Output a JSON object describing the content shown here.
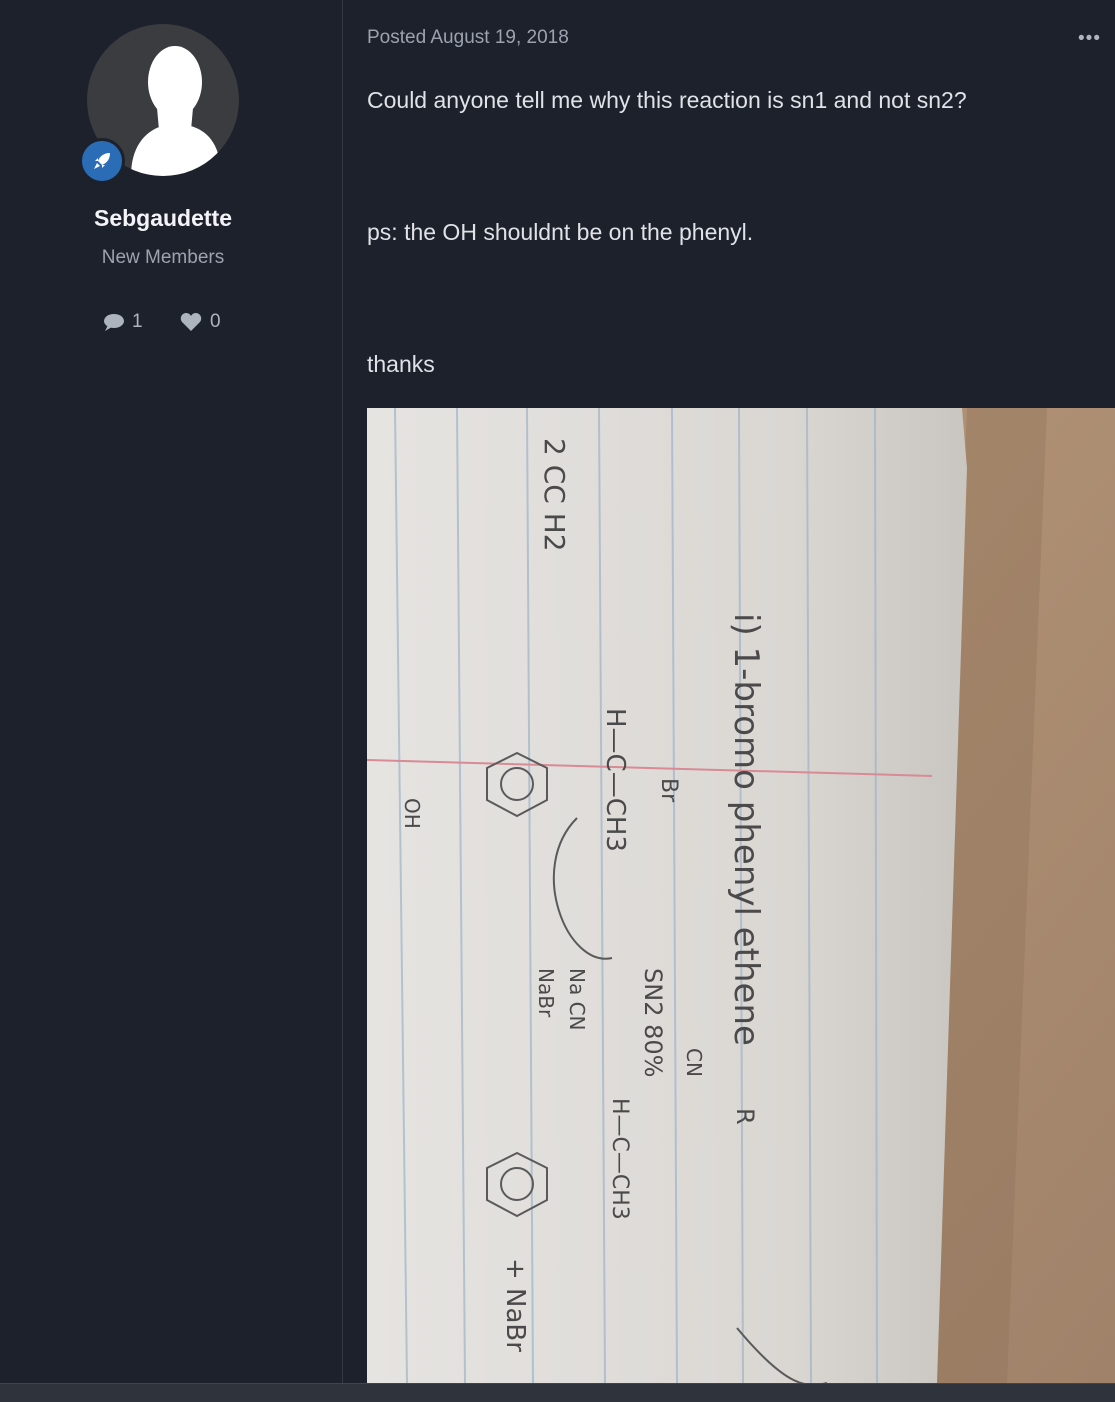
{
  "author": {
    "name": "Sebgaudette",
    "group": "New Members",
    "avatar_icon": "default-user-silhouette-icon",
    "badge_icon": "rocket-icon",
    "badge_color": "#2b6cb7",
    "stats": {
      "posts_icon": "comment-icon",
      "posts": "1",
      "reputation_icon": "heart-icon",
      "reputation": "0"
    }
  },
  "post": {
    "date": "Posted August 19, 2018",
    "menu_icon": "ellipsis-icon",
    "paragraphs": [
      "Could anyone tell me why this reaction is sn1 and not sn2?",
      "ps: the OH shouldnt be on the phenyl.",
      "thanks"
    ]
  },
  "attachment": {
    "type": "photo of handwritten notes",
    "handwriting": [
      "i) 1-bromo phenyl ethene",
      "2 CC H2",
      "Br",
      "H—C—CH3",
      "SN2 80%",
      "CN",
      "Na CN",
      "NaBr",
      "H—C—CH3",
      "OH",
      "+ NaBr",
      "R"
    ]
  },
  "colors": {
    "background": "#1d212b",
    "text": "#dfe2e7",
    "muted": "#9ca3af",
    "accent": "#2b6cb7"
  }
}
